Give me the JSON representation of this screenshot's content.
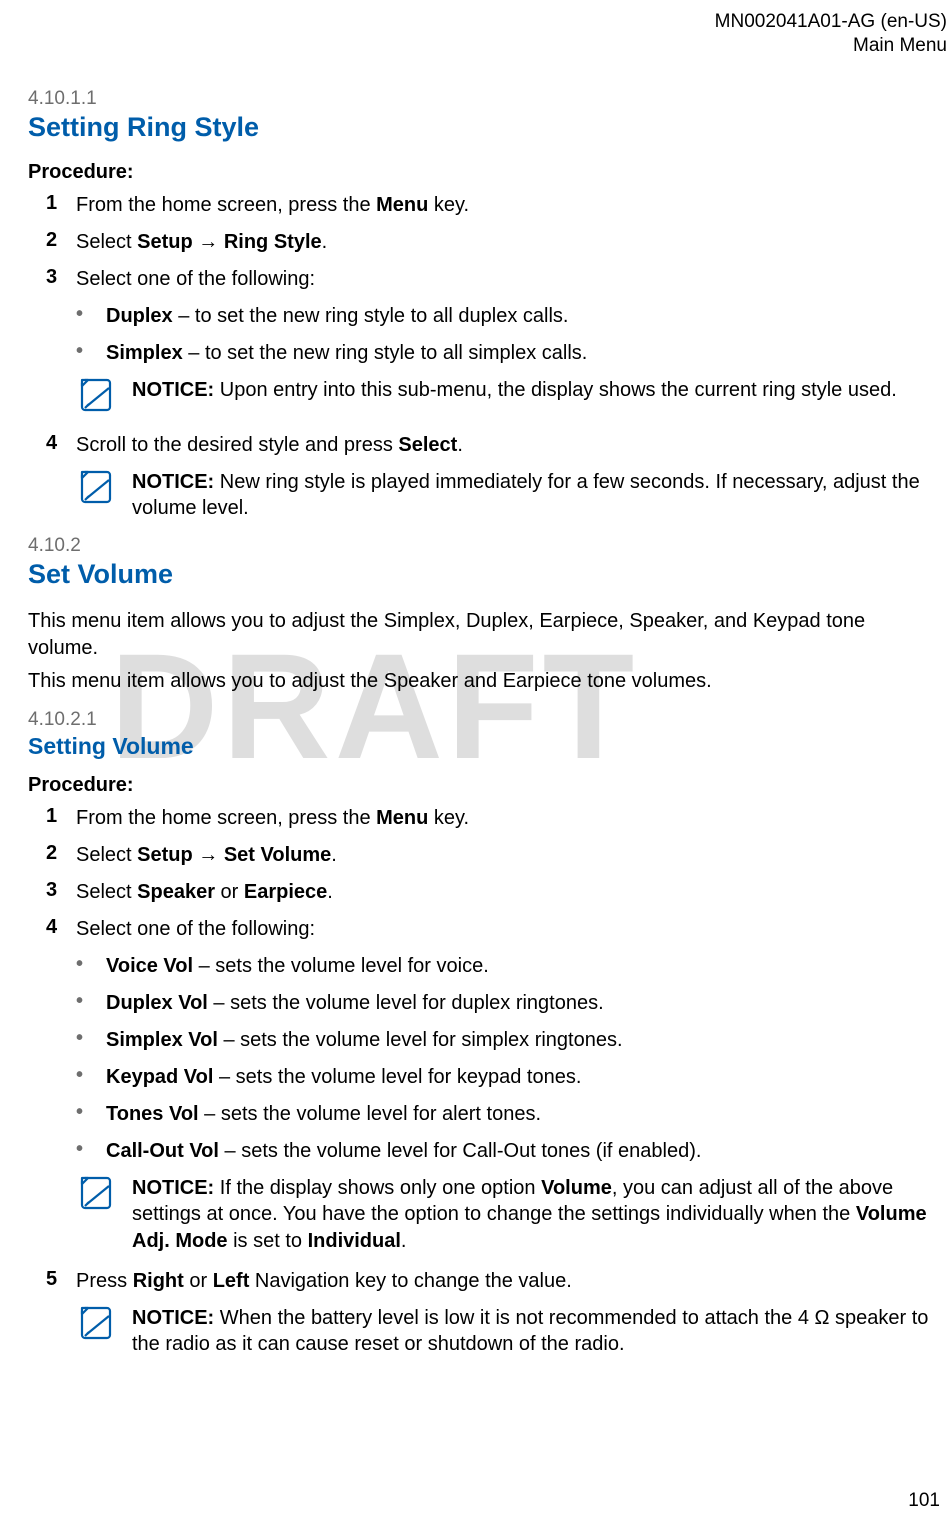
{
  "header": {
    "doc_id": "MN002041A01-AG (en-US)",
    "section": "Main Menu"
  },
  "watermark": "DRAFT",
  "page_number": "101",
  "s1": {
    "num": "4.10.1.1",
    "title": "Setting Ring Style",
    "proc_label": "Procedure:",
    "steps": {
      "n1": "1",
      "t1a": "From the home screen, press the ",
      "t1b": "Menu",
      "t1c": " key.",
      "n2": "2",
      "t2a": "Select ",
      "t2b": "Setup",
      "t2c": " → ",
      "t2d": "Ring Style",
      "t2e": ".",
      "n3": "3",
      "t3": "Select one of the following:",
      "b1a": "Duplex",
      "b1b": " – to set the new ring style to all duplex calls.",
      "b2a": "Simplex",
      "b2b": " – to set the new ring style to all simplex calls.",
      "notice1a": "NOTICE:",
      "notice1b": " Upon entry into this sub-menu, the display shows the current ring style used.",
      "n4": "4",
      "t4a": "Scroll to the desired style and press ",
      "t4b": "Select",
      "t4c": ".",
      "notice2a": "NOTICE:",
      "notice2b": " New ring style is played immediately for a few seconds. If necessary, adjust the volume level."
    }
  },
  "s2": {
    "num": "4.10.2",
    "title": "Set Volume",
    "para1": "This menu item allows you to adjust the Simplex, Duplex, Earpiece, Speaker, and Keypad tone volume.",
    "para2": "This menu item allows you to adjust the Speaker and Earpiece tone volumes."
  },
  "s3": {
    "num": "4.10.2.1",
    "title": "Setting Volume",
    "proc_label": "Procedure:",
    "steps": {
      "n1": "1",
      "t1a": "From the home screen, press the ",
      "t1b": "Menu",
      "t1c": " key.",
      "n2": "2",
      "t2a": "Select ",
      "t2b": "Setup",
      "t2c": " → ",
      "t2d": "Set Volume",
      "t2e": ".",
      "n3": "3",
      "t3a": "Select ",
      "t3b": "Speaker",
      "t3c": " or ",
      "t3d": "Earpiece",
      "t3e": ".",
      "n4": "4",
      "t4": "Select one of the following:",
      "b1a": "Voice Vol",
      "b1b": " – sets the volume level for voice.",
      "b2a": "Duplex Vol",
      "b2b": " – sets the volume level for duplex ringtones.",
      "b3a": "Simplex Vol",
      "b3b": " – sets the volume level for simplex ringtones.",
      "b4a": "Keypad Vol",
      "b4b": " – sets the volume level for keypad tones.",
      "b5a": "Tones Vol",
      "b5b": " – sets the volume level for alert tones.",
      "b6a": "Call-Out Vol",
      "b6b": " – sets the volume level for Call-Out tones (if enabled).",
      "notice1a": "NOTICE:",
      "notice1b": " If the display shows only one option ",
      "notice1c": "Volume",
      "notice1d": ", you can adjust all of the above settings at once. You have the option to change the settings individually when the ",
      "notice1e": "Volume Adj. Mode",
      "notice1f": " is set to ",
      "notice1g": "Individual",
      "notice1h": ".",
      "n5": "5",
      "t5a": "Press ",
      "t5b": "Right",
      "t5c": " or ",
      "t5d": "Left",
      "t5e": " Navigation key to change the value.",
      "notice2a": "NOTICE:",
      "notice2b": " When the battery level is low it is not recommended to attach the 4 Ω speaker to the radio as it can cause reset or shutdown of the radio."
    }
  }
}
